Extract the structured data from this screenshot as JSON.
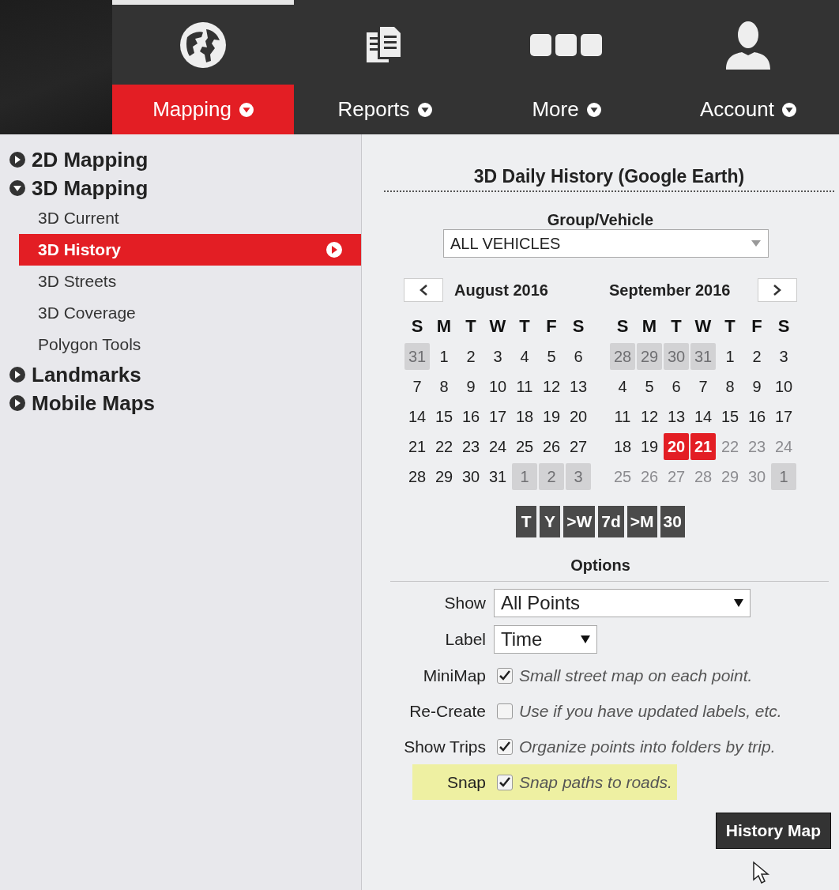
{
  "nav": [
    {
      "label": "Mapping",
      "kind": "globe",
      "selected": true
    },
    {
      "label": "Reports",
      "kind": "documents",
      "selected": false
    },
    {
      "label": "More",
      "kind": "dots",
      "selected": false
    },
    {
      "label": "Account",
      "kind": "person",
      "selected": false
    }
  ],
  "sidebar": {
    "items": [
      {
        "label": "2D Mapping",
        "expanded": false
      },
      {
        "label": "3D Mapping",
        "expanded": true,
        "children": [
          {
            "label": "3D Current",
            "selected": false
          },
          {
            "label": "3D History",
            "selected": true
          },
          {
            "label": "3D Streets",
            "selected": false
          },
          {
            "label": "3D Coverage",
            "selected": false
          },
          {
            "label": "Polygon Tools",
            "selected": false
          }
        ]
      },
      {
        "label": "Landmarks",
        "expanded": false
      },
      {
        "label": "Mobile Maps",
        "expanded": false
      }
    ]
  },
  "panel": {
    "title": "3D Daily History (Google Earth)",
    "group_label": "Group/Vehicle",
    "group_value": "ALL VEHICLES",
    "calendar": {
      "months": [
        {
          "title": "August 2016",
          "weekdays": [
            "S",
            "M",
            "T",
            "W",
            "T",
            "F",
            "S"
          ],
          "weeks": [
            [
              {
                "t": "31",
                "kind": "other"
              },
              {
                "t": "1",
                "kind": "day"
              },
              {
                "t": "2",
                "kind": "day"
              },
              {
                "t": "3",
                "kind": "day"
              },
              {
                "t": "4",
                "kind": "day"
              },
              {
                "t": "5",
                "kind": "day"
              },
              {
                "t": "6",
                "kind": "day"
              }
            ],
            [
              {
                "t": "7",
                "kind": "day"
              },
              {
                "t": "8",
                "kind": "day"
              },
              {
                "t": "9",
                "kind": "day"
              },
              {
                "t": "10",
                "kind": "day"
              },
              {
                "t": "11",
                "kind": "day"
              },
              {
                "t": "12",
                "kind": "day"
              },
              {
                "t": "13",
                "kind": "day"
              }
            ],
            [
              {
                "t": "14",
                "kind": "day"
              },
              {
                "t": "15",
                "kind": "day"
              },
              {
                "t": "16",
                "kind": "day"
              },
              {
                "t": "17",
                "kind": "day"
              },
              {
                "t": "18",
                "kind": "day"
              },
              {
                "t": "19",
                "kind": "day"
              },
              {
                "t": "20",
                "kind": "day"
              }
            ],
            [
              {
                "t": "21",
                "kind": "day"
              },
              {
                "t": "22",
                "kind": "day"
              },
              {
                "t": "23",
                "kind": "day"
              },
              {
                "t": "24",
                "kind": "day"
              },
              {
                "t": "25",
                "kind": "day"
              },
              {
                "t": "26",
                "kind": "day"
              },
              {
                "t": "27",
                "kind": "day"
              }
            ],
            [
              {
                "t": "28",
                "kind": "day"
              },
              {
                "t": "29",
                "kind": "day"
              },
              {
                "t": "30",
                "kind": "day"
              },
              {
                "t": "31",
                "kind": "day"
              },
              {
                "t": "1",
                "kind": "other"
              },
              {
                "t": "2",
                "kind": "other"
              },
              {
                "t": "3",
                "kind": "other"
              }
            ]
          ]
        },
        {
          "title": "September 2016",
          "weekdays": [
            "S",
            "M",
            "T",
            "W",
            "T",
            "F",
            "S"
          ],
          "weeks": [
            [
              {
                "t": "28",
                "kind": "other"
              },
              {
                "t": "29",
                "kind": "other"
              },
              {
                "t": "30",
                "kind": "other"
              },
              {
                "t": "31",
                "kind": "other"
              },
              {
                "t": "1",
                "kind": "day"
              },
              {
                "t": "2",
                "kind": "day"
              },
              {
                "t": "3",
                "kind": "day"
              }
            ],
            [
              {
                "t": "4",
                "kind": "day"
              },
              {
                "t": "5",
                "kind": "day"
              },
              {
                "t": "6",
                "kind": "day"
              },
              {
                "t": "7",
                "kind": "day"
              },
              {
                "t": "8",
                "kind": "day"
              },
              {
                "t": "9",
                "kind": "day"
              },
              {
                "t": "10",
                "kind": "day"
              }
            ],
            [
              {
                "t": "11",
                "kind": "day"
              },
              {
                "t": "12",
                "kind": "day"
              },
              {
                "t": "13",
                "kind": "day"
              },
              {
                "t": "14",
                "kind": "day"
              },
              {
                "t": "15",
                "kind": "day"
              },
              {
                "t": "16",
                "kind": "day"
              },
              {
                "t": "17",
                "kind": "day"
              }
            ],
            [
              {
                "t": "18",
                "kind": "day"
              },
              {
                "t": "19",
                "kind": "day"
              },
              {
                "t": "20",
                "kind": "selected"
              },
              {
                "t": "21",
                "kind": "selected"
              },
              {
                "t": "22",
                "kind": "future"
              },
              {
                "t": "23",
                "kind": "future"
              },
              {
                "t": "24",
                "kind": "future"
              }
            ],
            [
              {
                "t": "25",
                "kind": "future"
              },
              {
                "t": "26",
                "kind": "future"
              },
              {
                "t": "27",
                "kind": "future"
              },
              {
                "t": "28",
                "kind": "future"
              },
              {
                "t": "29",
                "kind": "future"
              },
              {
                "t": "30",
                "kind": "future"
              },
              {
                "t": "1",
                "kind": "other"
              }
            ]
          ]
        }
      ]
    },
    "quick_buttons": [
      "T",
      "Y",
      ">W",
      "7d",
      ">M",
      "30"
    ],
    "options_title": "Options",
    "selects": [
      {
        "label": "Show",
        "value": "All Points",
        "kind": "wide"
      },
      {
        "label": "Label",
        "value": "Time",
        "kind": "narrow"
      }
    ],
    "checks": [
      {
        "label": "MiniMap",
        "checked": true,
        "hint": "Small street map on each point.",
        "highlighted": false
      },
      {
        "label": "Re-Create",
        "checked": false,
        "hint": "Use if you have updated labels, etc.",
        "highlighted": false
      },
      {
        "label": "Show Trips",
        "checked": true,
        "hint": "Organize points into folders by trip.",
        "highlighted": false
      },
      {
        "label": "Snap",
        "checked": true,
        "hint": "Snap paths to roads.",
        "highlighted": true
      }
    ],
    "submit": "History Map"
  }
}
